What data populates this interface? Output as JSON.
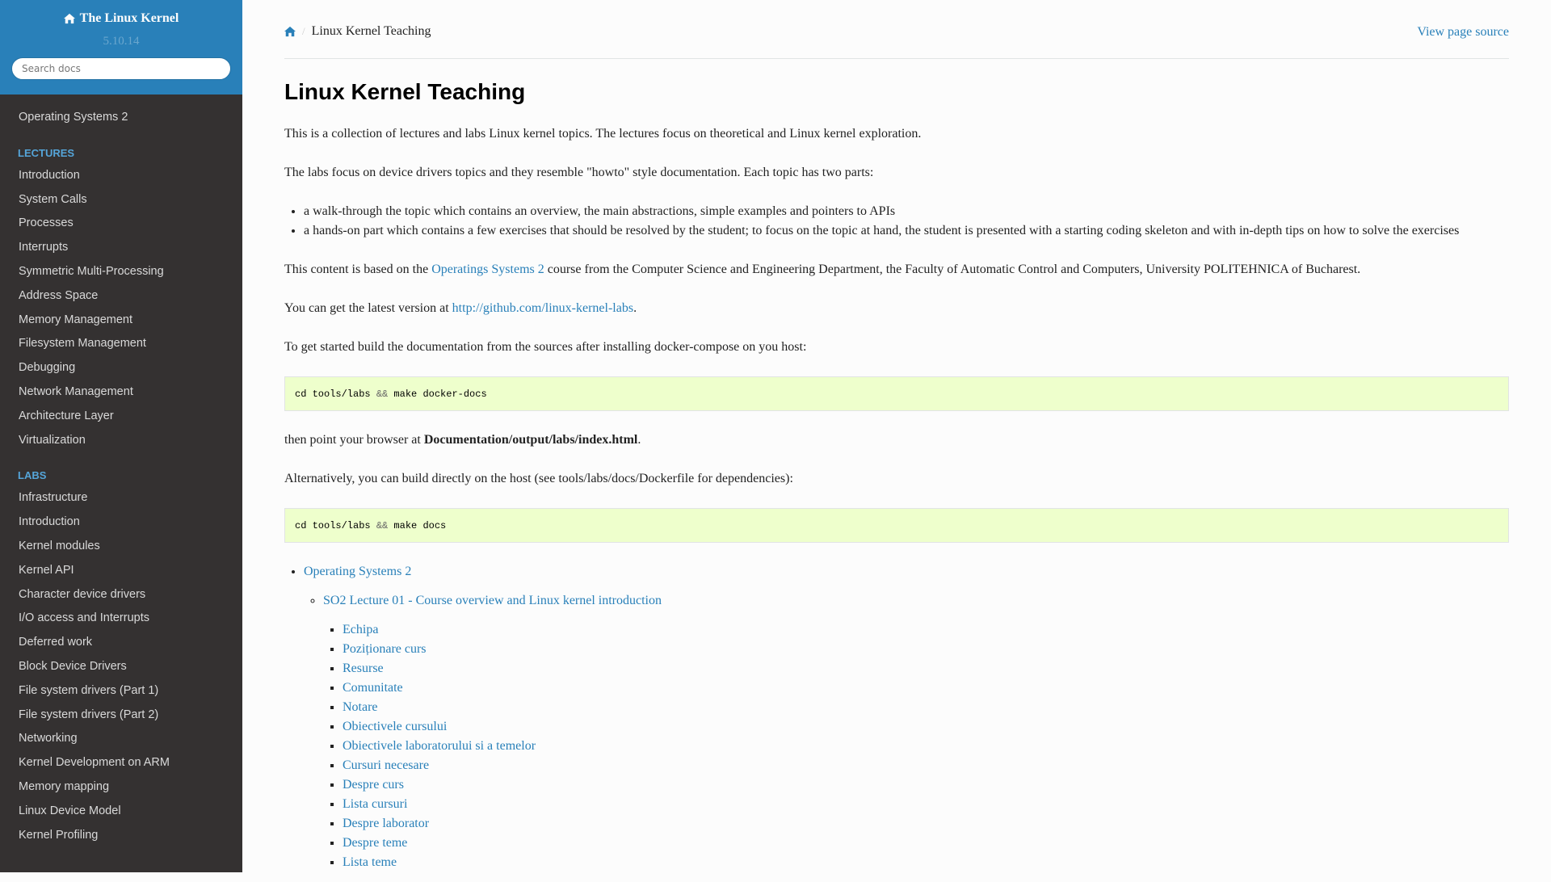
{
  "sidebar": {
    "project_title": "The Linux Kernel",
    "version": "5.10.14",
    "search_placeholder": "Search docs",
    "top_item": "Operating Systems 2",
    "lectures_caption": "LECTURES",
    "lectures": [
      "Introduction",
      "System Calls",
      "Processes",
      "Interrupts",
      "Symmetric Multi-Processing",
      "Address Space",
      "Memory Management",
      "Filesystem Management",
      "Debugging",
      "Network Management",
      "Architecture Layer",
      "Virtualization"
    ],
    "labs_caption": "LABS",
    "labs": [
      "Infrastructure",
      "Introduction",
      "Kernel modules",
      "Kernel API",
      "Character device drivers",
      "I/O access and Interrupts",
      "Deferred work",
      "Block Device Drivers",
      "File system drivers (Part 1)",
      "File system drivers (Part 2)",
      "Networking",
      "Kernel Development on ARM",
      "Memory mapping",
      "Linux Device Model",
      "Kernel Profiling"
    ]
  },
  "breadcrumb": {
    "separator": "/",
    "current": "Linux Kernel Teaching",
    "view_source": "View page source"
  },
  "content": {
    "title": "Linux Kernel Teaching",
    "p1": "This is a collection of lectures and labs Linux kernel topics. The lectures focus on theoretical and Linux kernel exploration.",
    "p2": "The labs focus on device drivers topics and they resemble \"howto\" style documentation. Each topic has two parts:",
    "bullets": [
      "a walk-through the topic which contains an overview, the main abstractions, simple examples and pointers to APIs",
      "a hands-on part which contains a few exercises that should be resolved by the student; to focus on the topic at hand, the student is presented with a starting coding skeleton and with in-depth tips on how to solve the exercises"
    ],
    "p3_before": "This content is based on the ",
    "p3_link": "Operatings Systems 2",
    "p3_after": " course from the Computer Science and Engineering Department, the Faculty of Automatic Control and Computers, University POLITEHNICA of Bucharest.",
    "p4_before": "You can get the latest version at ",
    "p4_link": "http://github.com/linux-kernel-labs",
    "p4_after": ".",
    "p5": "To get started build the documentation from the sources after installing docker-compose on you host:",
    "code1": {
      "cmd1": "cd tools/labs ",
      "op": "&&",
      "cmd2": " make docker-docs"
    },
    "p6_before": "then point your browser at ",
    "p6_bold": "Documentation/output/labs/index.html",
    "p6_after": ".",
    "p7": "Alternatively, you can build directly on the host (see tools/labs/docs/Dockerfile for dependencies):",
    "code2": {
      "cmd1": "cd tools/labs ",
      "op": "&&",
      "cmd2": " make docs"
    },
    "toc": {
      "level1": "Operating Systems 2",
      "level2": "SO2 Lecture 01 - Course overview and Linux kernel introduction",
      "level3": [
        "Echipa",
        "Poziționare curs",
        "Resurse",
        "Comunitate",
        "Notare",
        "Obiectivele cursului",
        "Obiectivele laboratorului si a temelor",
        "Cursuri necesare",
        "Despre curs",
        "Lista cursuri",
        "Despre laborator",
        "Despre teme",
        "Lista teme"
      ]
    }
  }
}
